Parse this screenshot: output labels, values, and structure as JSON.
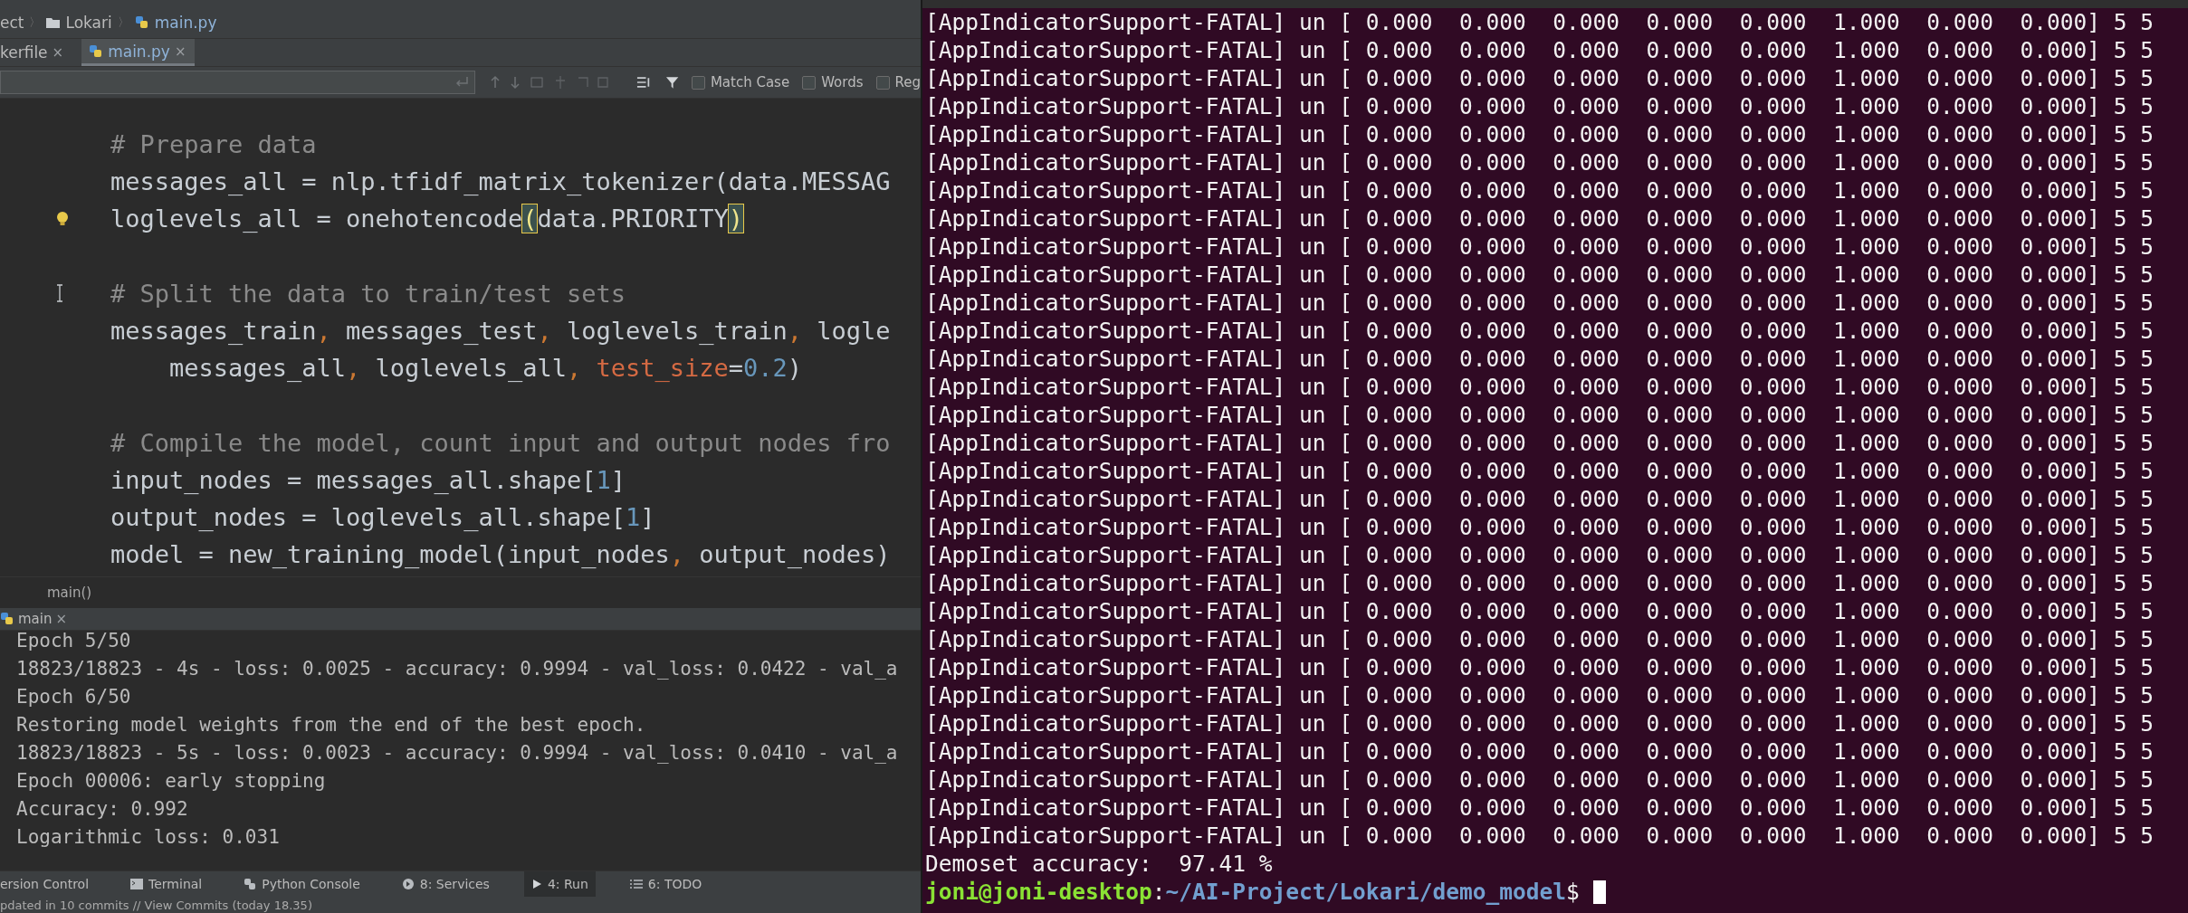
{
  "ide": {
    "breadcrumbs": [
      {
        "kind": "text",
        "label": "ect"
      },
      {
        "kind": "folder",
        "label": "Lokari",
        "separator": "〉"
      },
      {
        "kind": "python",
        "label": "main.py",
        "separator": "〉"
      }
    ],
    "tabs": [
      {
        "label": "kerfile",
        "close": "×",
        "selected": false
      },
      {
        "label": "main.py",
        "close": "×",
        "selected": true
      }
    ],
    "find_bar": {
      "options": [
        {
          "label": "Match Case",
          "checked": false
        },
        {
          "label": "Words",
          "checked": false
        },
        {
          "label": "Reg",
          "checked": false
        }
      ]
    },
    "code_lines": [
      {
        "kind": "code",
        "tokens": [
          {
            "kind": "comment",
            "text": "# Prepare data"
          }
        ]
      },
      {
        "kind": "code",
        "tokens": [
          {
            "kind": "plain",
            "text": "messages_all = nlp.tfidf_matrix_tokenizer(data.MESSAG"
          }
        ]
      },
      {
        "kind": "bulb",
        "tokens": [
          {
            "kind": "plain",
            "text": "loglevels_all = onehotencode"
          },
          {
            "kind": "match",
            "text": "("
          },
          {
            "kind": "plain",
            "text": "data.PRIORITY"
          },
          {
            "kind": "match",
            "text": ")"
          }
        ]
      },
      {
        "kind": "blank"
      },
      {
        "kind": "caret",
        "tokens": [
          {
            "kind": "comment",
            "text": "# Split the data to train/test sets"
          }
        ]
      },
      {
        "kind": "code",
        "tokens": [
          {
            "kind": "plain",
            "text": "messages_train"
          },
          {
            "kind": "punct",
            "text": ", "
          },
          {
            "kind": "plain",
            "text": "messages_test"
          },
          {
            "kind": "punct",
            "text": ", "
          },
          {
            "kind": "plain",
            "text": "loglevels_train"
          },
          {
            "kind": "punct",
            "text": ", "
          },
          {
            "kind": "plain",
            "text": "logle"
          }
        ]
      },
      {
        "kind": "code",
        "tokens": [
          {
            "kind": "plain",
            "text": "    messages_all"
          },
          {
            "kind": "punct",
            "text": ", "
          },
          {
            "kind": "plain",
            "text": "loglevels_all"
          },
          {
            "kind": "punct",
            "text": ", "
          },
          {
            "kind": "keyarg",
            "text": "test_size"
          },
          {
            "kind": "plain",
            "text": "="
          },
          {
            "kind": "number",
            "text": "0.2"
          },
          {
            "kind": "plain",
            "text": ")"
          }
        ]
      },
      {
        "kind": "blank"
      },
      {
        "kind": "code",
        "tokens": [
          {
            "kind": "comment",
            "text": "# Compile the model, count input and output nodes fro"
          }
        ]
      },
      {
        "kind": "code",
        "tokens": [
          {
            "kind": "plain",
            "text": "input_nodes = messages_all.shape["
          },
          {
            "kind": "number",
            "text": "1"
          },
          {
            "kind": "plain",
            "text": "]"
          }
        ]
      },
      {
        "kind": "code",
        "tokens": [
          {
            "kind": "plain",
            "text": "output_nodes = loglevels_all.shape["
          },
          {
            "kind": "number",
            "text": "1"
          },
          {
            "kind": "plain",
            "text": "]"
          }
        ]
      },
      {
        "kind": "code",
        "tokens": [
          {
            "kind": "plain",
            "text": "model = new_training_model(input_nodes"
          },
          {
            "kind": "punct",
            "text": ", "
          },
          {
            "kind": "plain",
            "text": "output_nodes)"
          }
        ]
      }
    ],
    "editor_breadcrumb": "main()",
    "run_tab": {
      "label": "main",
      "close": "×"
    },
    "output_lines": [
      "Epoch 5/50",
      "18823/18823 - 4s - loss: 0.0025 - accuracy: 0.9994 - val_loss: 0.0422 - val_a",
      "Epoch 6/50",
      "Restoring model weights from the end of the best epoch.",
      "18823/18823 - 5s - loss: 0.0023 - accuracy: 0.9994 - val_loss: 0.0410 - val_a",
      "Epoch 00006: early stopping",
      "Accuracy: 0.992",
      "Logarithmic loss: 0.031"
    ],
    "tool_windows": [
      {
        "kind": "none",
        "label": "ersion Control",
        "selected": false
      },
      {
        "kind": "terminal",
        "label": "Terminal",
        "selected": false
      },
      {
        "kind": "python",
        "label": "Python Console",
        "selected": false
      },
      {
        "kind": "services",
        "label": "8: Services",
        "selected": false
      },
      {
        "kind": "run",
        "label": "4: Run",
        "selected": true
      },
      {
        "kind": "todo",
        "label": "6: TODO",
        "selected": false
      }
    ],
    "status_text": "pdated in 10 commits // View Commits (today 18.35)"
  },
  "terminal": {
    "lines": [
      "[AppIndicatorSupport-FATAL] un [ 0.000  0.000  0.000  0.000  0.000  1.000  0.000  0.000] 5 5",
      "[AppIndicatorSupport-FATAL] un [ 0.000  0.000  0.000  0.000  0.000  1.000  0.000  0.000] 5 5",
      "[AppIndicatorSupport-FATAL] un [ 0.000  0.000  0.000  0.000  0.000  1.000  0.000  0.000] 5 5",
      "[AppIndicatorSupport-FATAL] un [ 0.000  0.000  0.000  0.000  0.000  1.000  0.000  0.000] 5 5",
      "[AppIndicatorSupport-FATAL] un [ 0.000  0.000  0.000  0.000  0.000  1.000  0.000  0.000] 5 5",
      "[AppIndicatorSupport-FATAL] un [ 0.000  0.000  0.000  0.000  0.000  1.000  0.000  0.000] 5 5",
      "[AppIndicatorSupport-FATAL] un [ 0.000  0.000  0.000  0.000  0.000  1.000  0.000  0.000] 5 5",
      "[AppIndicatorSupport-FATAL] un [ 0.000  0.000  0.000  0.000  0.000  1.000  0.000  0.000] 5 5",
      "[AppIndicatorSupport-FATAL] un [ 0.000  0.000  0.000  0.000  0.000  1.000  0.000  0.000] 5 5",
      "[AppIndicatorSupport-FATAL] un [ 0.000  0.000  0.000  0.000  0.000  1.000  0.000  0.000] 5 5",
      "[AppIndicatorSupport-FATAL] un [ 0.000  0.000  0.000  0.000  0.000  1.000  0.000  0.000] 5 5",
      "[AppIndicatorSupport-FATAL] un [ 0.000  0.000  0.000  0.000  0.000  1.000  0.000  0.000] 5 5",
      "[AppIndicatorSupport-FATAL] un [ 0.000  0.000  0.000  0.000  0.000  1.000  0.000  0.000] 5 5",
      "[AppIndicatorSupport-FATAL] un [ 0.000  0.000  0.000  0.000  0.000  1.000  0.000  0.000] 5 5",
      "[AppIndicatorSupport-FATAL] un [ 0.000  0.000  0.000  0.000  0.000  1.000  0.000  0.000] 5 5",
      "[AppIndicatorSupport-FATAL] un [ 0.000  0.000  0.000  0.000  0.000  1.000  0.000  0.000] 5 5",
      "[AppIndicatorSupport-FATAL] un [ 0.000  0.000  0.000  0.000  0.000  1.000  0.000  0.000] 5 5",
      "[AppIndicatorSupport-FATAL] un [ 0.000  0.000  0.000  0.000  0.000  1.000  0.000  0.000] 5 5",
      "[AppIndicatorSupport-FATAL] un [ 0.000  0.000  0.000  0.000  0.000  1.000  0.000  0.000] 5 5",
      "[AppIndicatorSupport-FATAL] un [ 0.000  0.000  0.000  0.000  0.000  1.000  0.000  0.000] 5 5",
      "[AppIndicatorSupport-FATAL] un [ 0.000  0.000  0.000  0.000  0.000  1.000  0.000  0.000] 5 5",
      "[AppIndicatorSupport-FATAL] un [ 0.000  0.000  0.000  0.000  0.000  1.000  0.000  0.000] 5 5",
      "[AppIndicatorSupport-FATAL] un [ 0.000  0.000  0.000  0.000  0.000  1.000  0.000  0.000] 5 5",
      "[AppIndicatorSupport-FATAL] un [ 0.000  0.000  0.000  0.000  0.000  1.000  0.000  0.000] 5 5",
      "[AppIndicatorSupport-FATAL] un [ 0.000  0.000  0.000  0.000  0.000  1.000  0.000  0.000] 5 5",
      "[AppIndicatorSupport-FATAL] un [ 0.000  0.000  0.000  0.000  0.000  1.000  0.000  0.000] 5 5",
      "[AppIndicatorSupport-FATAL] un [ 0.000  0.000  0.000  0.000  0.000  1.000  0.000  0.000] 5 5",
      "[AppIndicatorSupport-FATAL] un [ 0.000  0.000  0.000  0.000  0.000  1.000  0.000  0.000] 5 5",
      "[AppIndicatorSupport-FATAL] un [ 0.000  0.000  0.000  0.000  0.000  1.000  0.000  0.000] 5 5",
      "[AppIndicatorSupport-FATAL] un [ 0.000  0.000  0.000  0.000  0.000  1.000  0.000  0.000] 5 5",
      "Demoset accuracy:  97.41 %"
    ],
    "prompt": [
      {
        "kind": "user",
        "text": "joni@joni-desktop"
      },
      {
        "kind": "plain",
        "text": ":"
      },
      {
        "kind": "path",
        "text": "~/AI-Project/Lokari/demo_model"
      },
      {
        "kind": "plain",
        "text": "$ "
      }
    ]
  }
}
